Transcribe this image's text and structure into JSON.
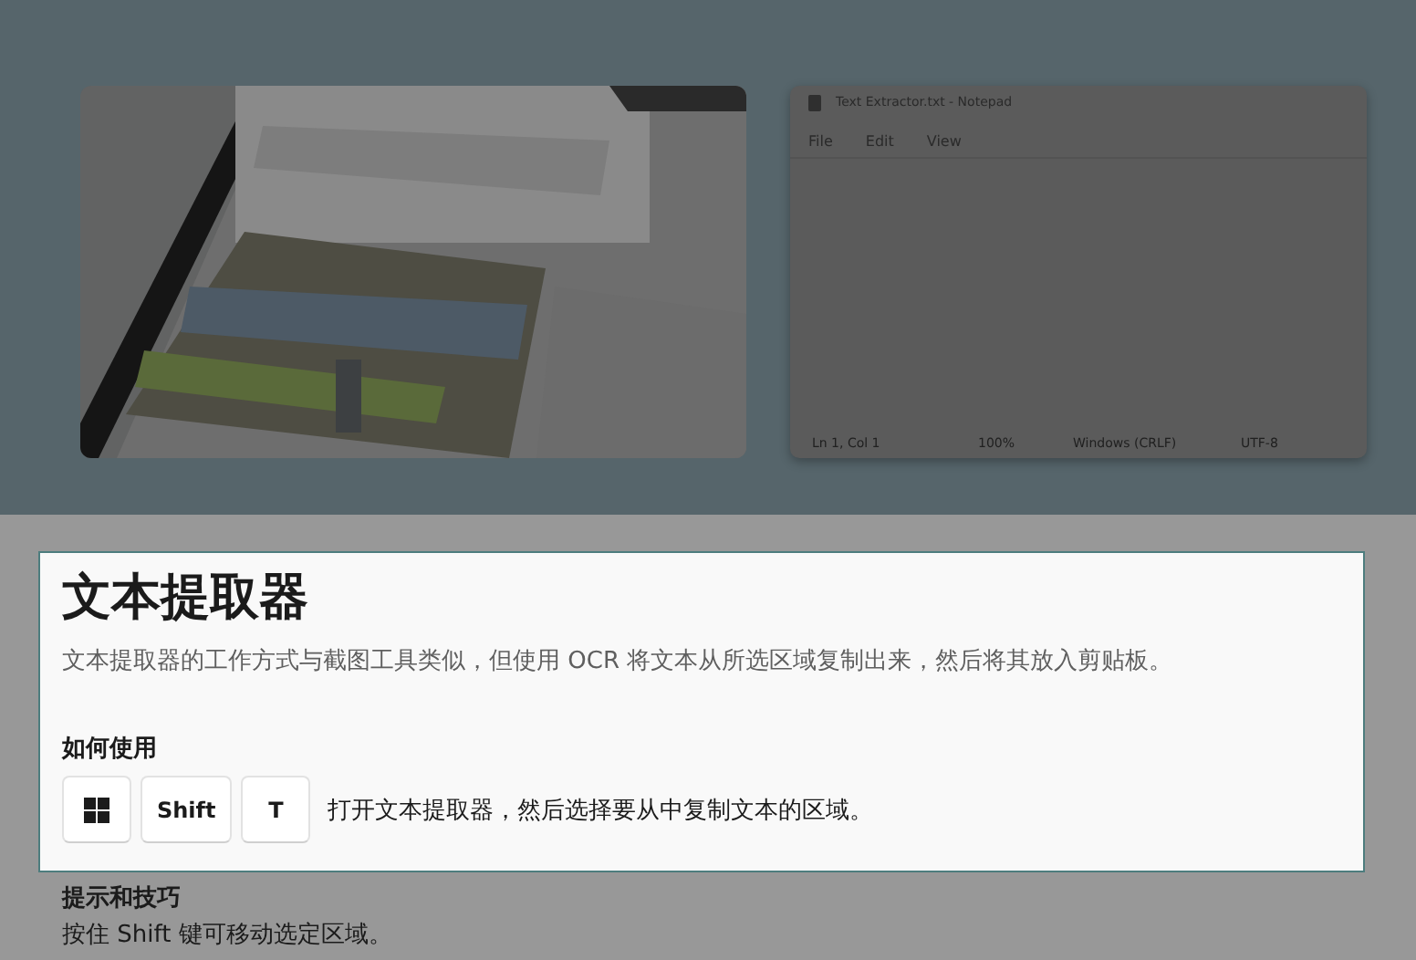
{
  "hero": {
    "notepad": {
      "title": "Text Extractor.txt - Notepad",
      "menu": [
        "File",
        "Edit",
        "View"
      ],
      "status": [
        "Ln 1, Col 1",
        "100%",
        "Windows (CRLF)",
        "UTF-8"
      ]
    }
  },
  "card": {
    "title": "文本提取器",
    "description": "文本提取器的工作方式与截图工具类似，但使用 OCR 将文本从所选区域复制出来，然后将其放入剪贴板。",
    "how_to": {
      "heading": "如何使用",
      "keys": [
        {
          "kind": "windows"
        },
        {
          "kind": "text",
          "label": "Shift"
        },
        {
          "kind": "text",
          "label": "T"
        }
      ],
      "instruction": "打开文本提取器，然后选择要从中复制文本的区域。"
    }
  },
  "tips": {
    "heading": "提示和技巧",
    "text": "按住 Shift 键可移动选定区域。"
  }
}
